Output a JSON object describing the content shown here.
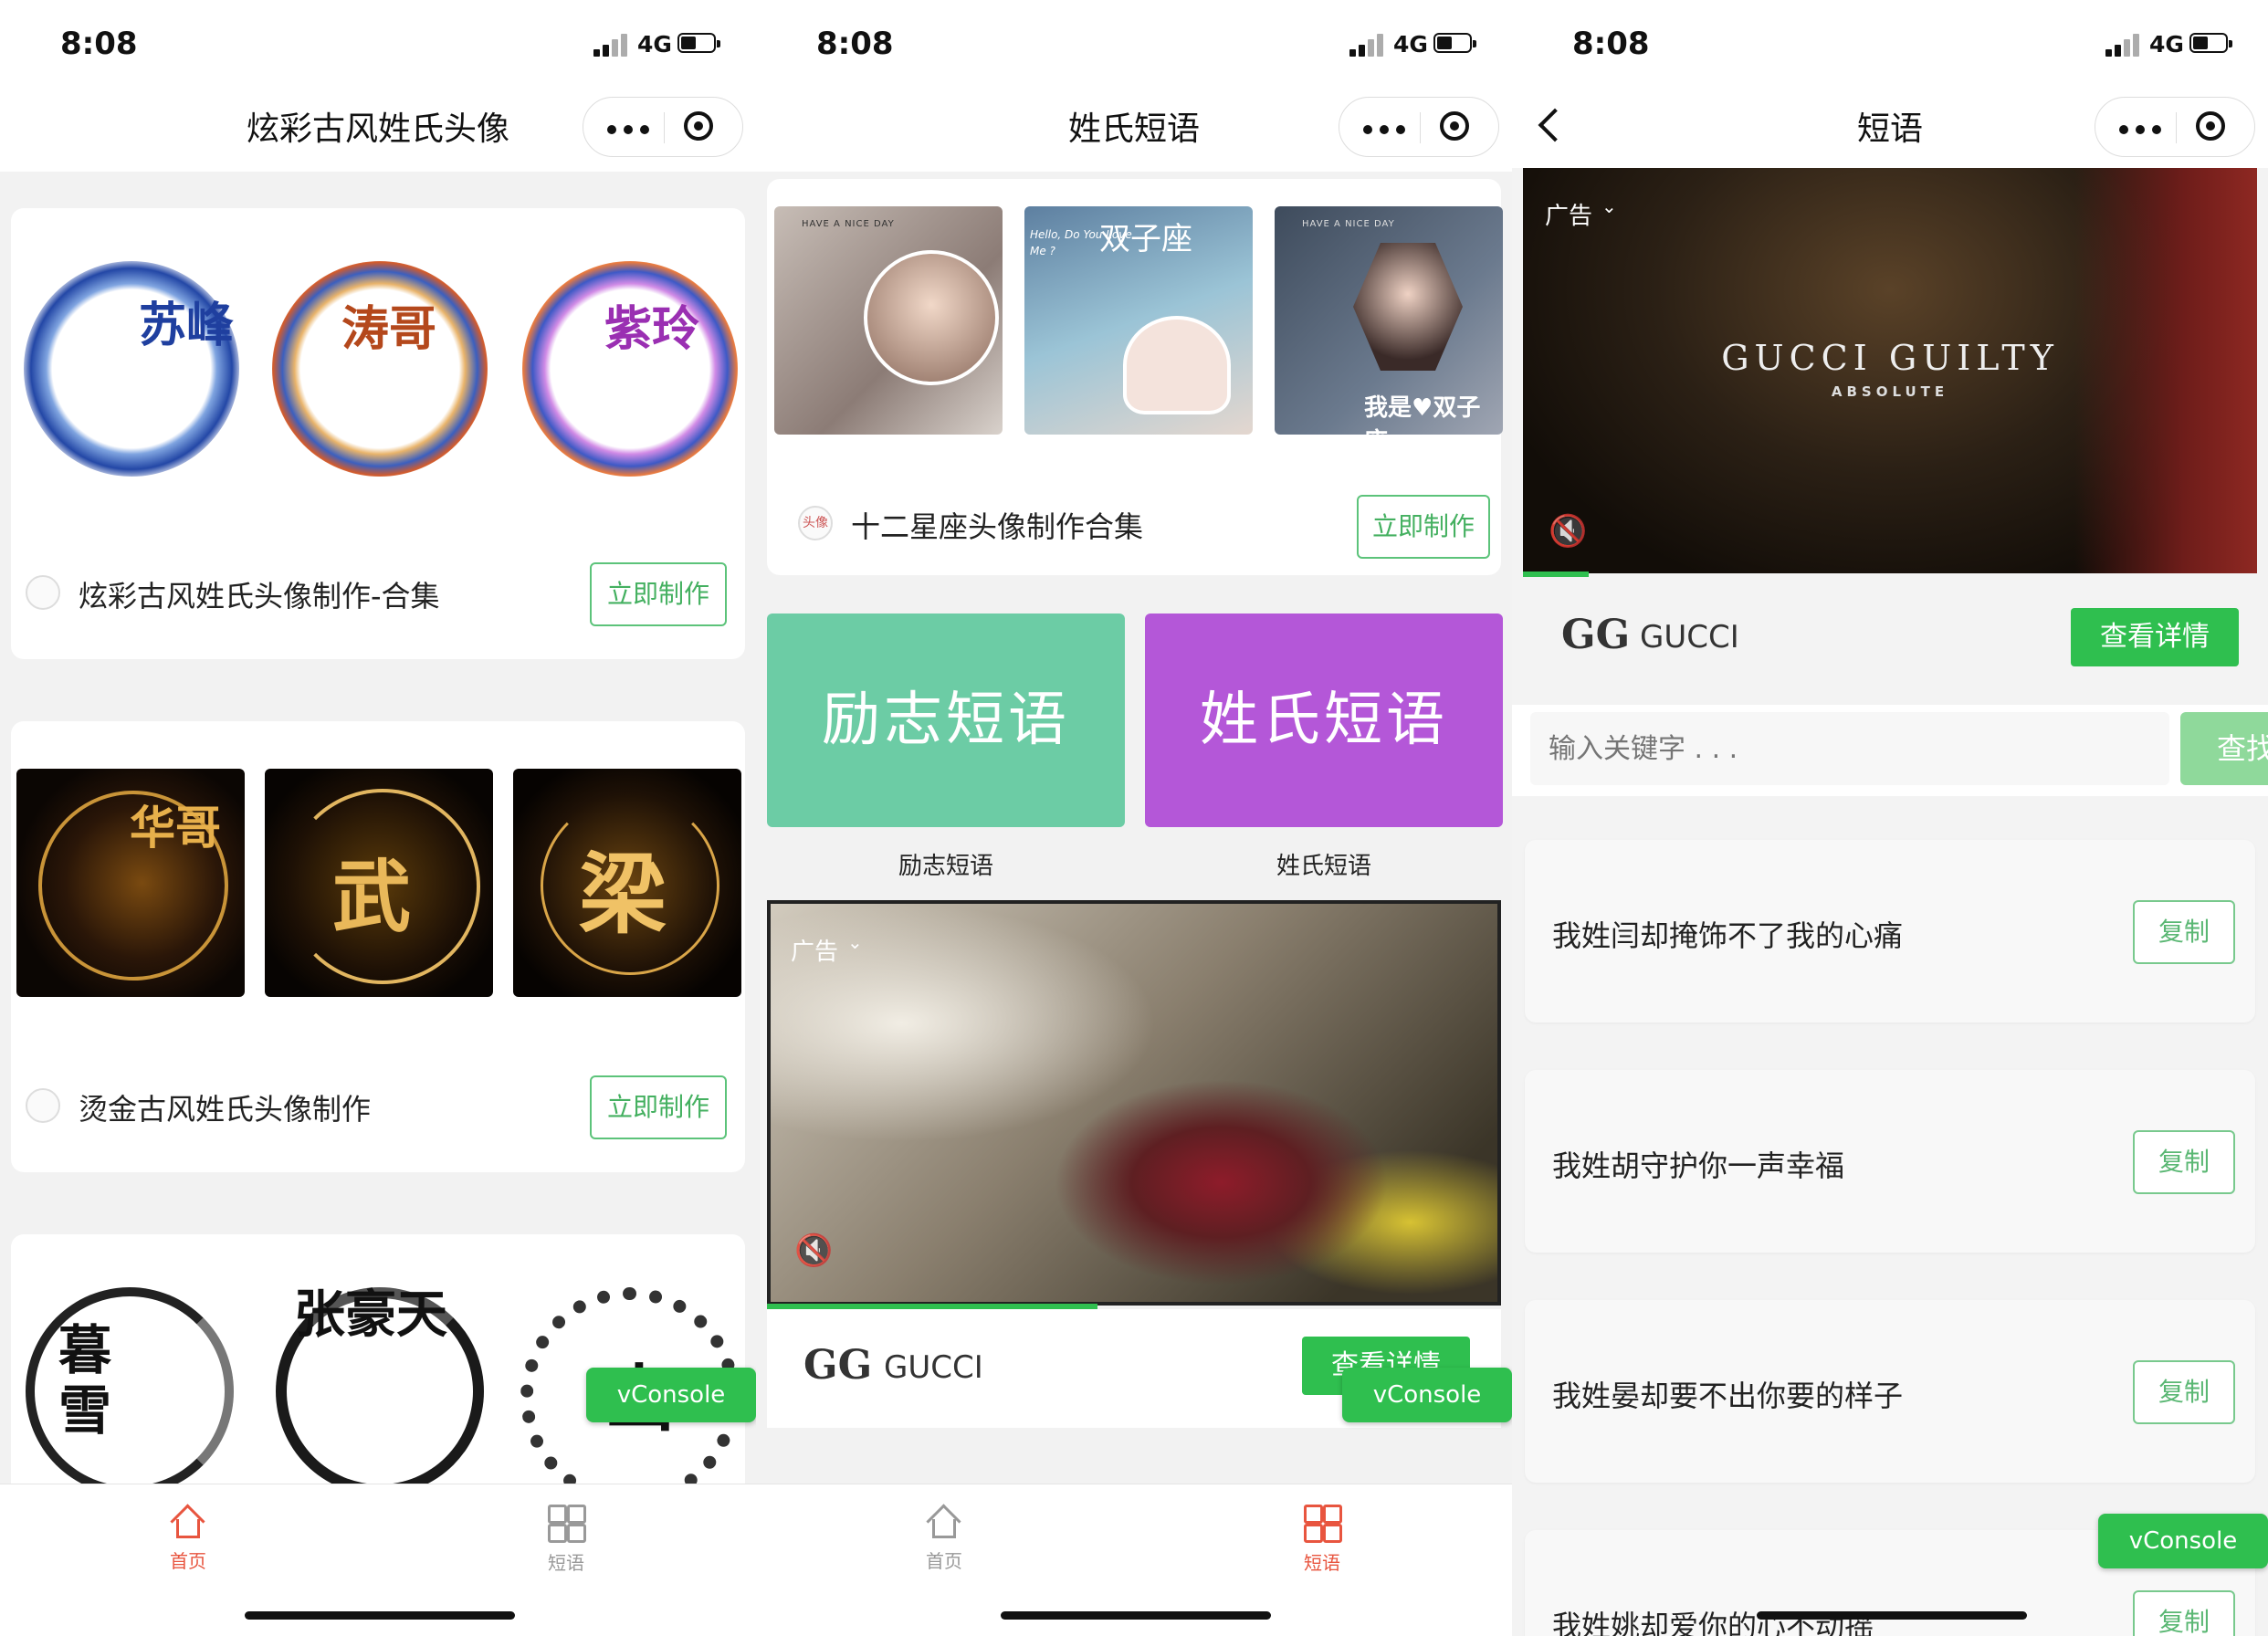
{
  "status_bar": {
    "time": "8:08",
    "network": "4G"
  },
  "panel1": {
    "title": "炫彩古风姓氏头像",
    "cards": [
      {
        "title": "炫彩古风姓氏头像制作-合集",
        "button": "立即制作",
        "names": [
          "苏峰",
          "涛哥",
          "紫玲"
        ]
      },
      {
        "title": "烫金古风姓氏头像制作",
        "button": "立即制作",
        "names": [
          "华哥",
          "武",
          "梁"
        ]
      },
      {
        "names": [
          "暮雪",
          "张豪天",
          "山"
        ]
      }
    ]
  },
  "panel2": {
    "title": "姓氏短语",
    "zodiac": {
      "title": "十二星座头像制作合集",
      "button": "立即制作",
      "logo_text": "头像",
      "images_text": [
        "HAVE A NICE DAY",
        "Hello, Do You Love Me ?",
        "双子座",
        "HAVE A NICE DAY",
        "我是",
        "双子座"
      ]
    },
    "categories": [
      {
        "label": "励志短语",
        "caption": "励志短语",
        "color": "#6ccca5"
      },
      {
        "label": "姓氏短语",
        "caption": "姓氏短语",
        "color": "#b457d8"
      }
    ],
    "ad": {
      "tag": "广告",
      "brand": "GUCCI",
      "button": "查看详情"
    }
  },
  "panel3": {
    "title": "短语",
    "ad": {
      "tag": "广告",
      "headline": "GUCCI GUILTY",
      "subline": "ABSOLUTE",
      "brand": "GUCCI",
      "button": "查看详情"
    },
    "search": {
      "placeholder": "输入关键字 . . .",
      "button": "查找"
    },
    "quotes": [
      {
        "text": "我姓闫却掩饰不了我的心痛",
        "button": "复制"
      },
      {
        "text": "我姓胡守护你一声幸福",
        "button": "复制"
      },
      {
        "text": "我姓晏却要不出你要的样子",
        "button": "复制"
      },
      {
        "text": "我姓姚却爱你的心不动摇",
        "button": "复制"
      }
    ]
  },
  "tabbar": {
    "home": "首页",
    "phrases": "短语"
  },
  "vconsole": "vConsole",
  "colors": {
    "accent_green": "#44b060",
    "active_tab": "#e8553f",
    "inactive_tab": "#999999"
  }
}
